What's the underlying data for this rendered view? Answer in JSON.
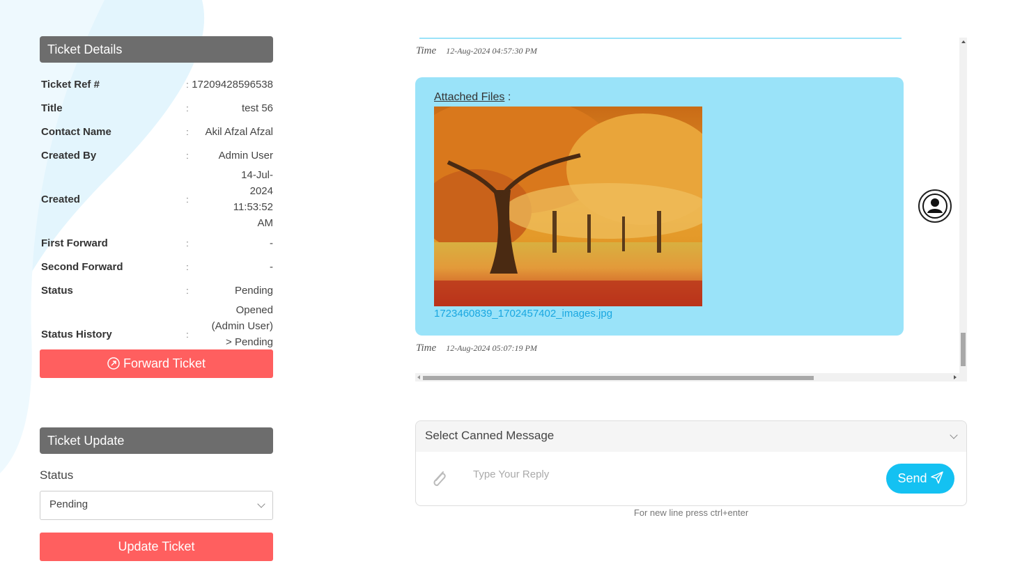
{
  "ticket_details": {
    "heading": "Ticket Details",
    "separator": ":",
    "rows": [
      {
        "label": "Ticket Ref #",
        "value": "17209428596538"
      },
      {
        "label": "Title",
        "value": "test 56"
      },
      {
        "label": "Contact Name",
        "value": "Akil Afzal Afzal"
      },
      {
        "label": "Created By",
        "value": "Admin User"
      },
      {
        "label": "Created",
        "value": "14-Jul-2024 11:53:52 AM"
      },
      {
        "label": "First Forward",
        "value": "-"
      },
      {
        "label": "Second Forward",
        "value": "-"
      },
      {
        "label": "Status",
        "value": "Pending"
      },
      {
        "label": "Status History",
        "value": "Opened (Admin User) > Pending (Admin User)"
      }
    ],
    "forward_button": "Forward Ticket"
  },
  "ticket_update": {
    "heading": "Ticket Update",
    "status_label": "Status",
    "status_value": "Pending",
    "update_button": "Update Ticket"
  },
  "conversation": {
    "time_label": "Time",
    "first_time": "12-Aug-2024 04:57:30 PM",
    "attached_files_label": "Attached Files",
    "attached_files_colon": ":",
    "file_name": "1723460839_1702457402_images.jpg",
    "second_time": "12-Aug-2024 05:07:19 PM",
    "bubble_color": "#9ae3f9"
  },
  "reply": {
    "canned_placeholder": "Select Canned Message",
    "input_placeholder": "Type Your Reply",
    "send_label": "Send",
    "hint": "For new line press ctrl+enter"
  },
  "colors": {
    "accent_red": "#ff5f5f",
    "header_gray": "#6d6d6d",
    "send_blue": "#14c1f2",
    "link_blue": "#1aa7e0"
  },
  "icons": [
    "forward-circle-icon",
    "chevron-down-icon",
    "paperclip-icon",
    "send-plane-icon",
    "user-avatar-icon",
    "autumn-tree-image"
  ]
}
